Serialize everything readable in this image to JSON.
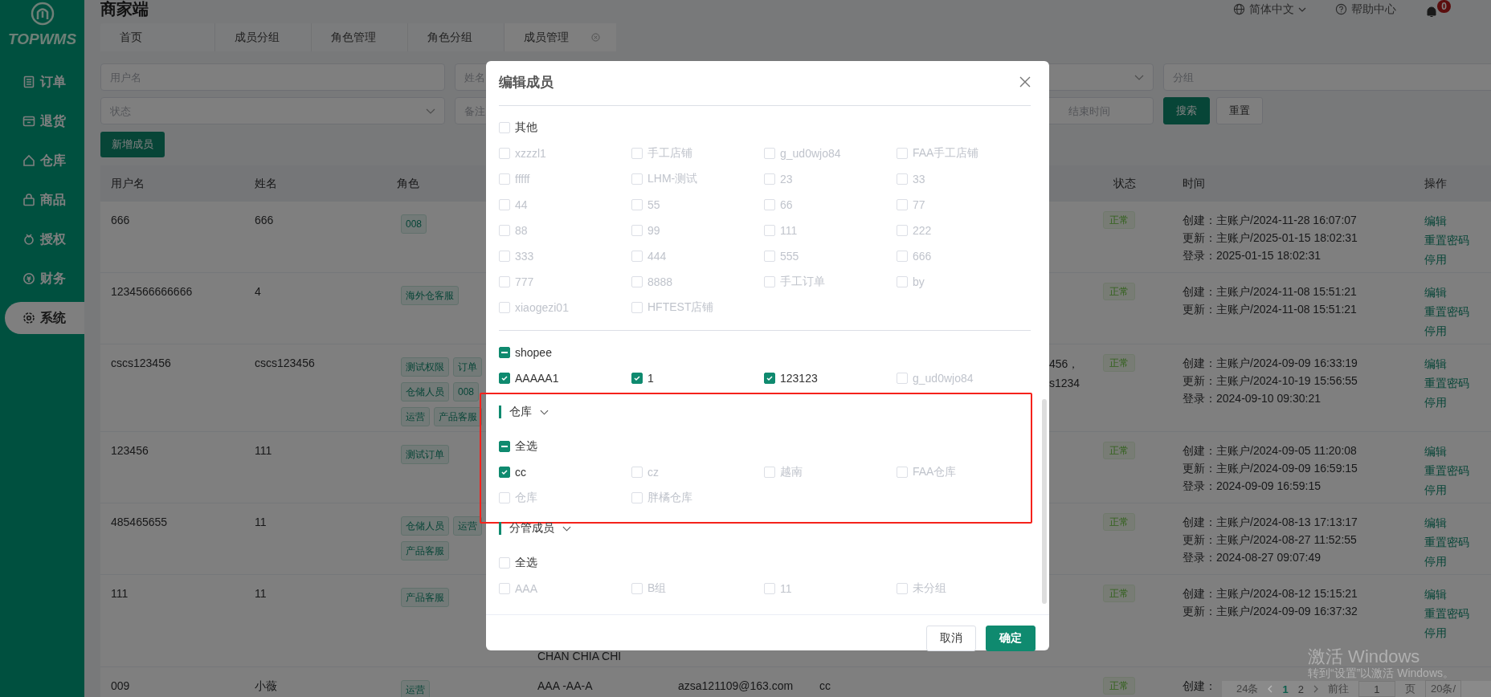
{
  "app": {
    "logo": "TOPWMS",
    "title": "商家端"
  },
  "sidebar": {
    "items": [
      {
        "label": "订单",
        "selected": false
      },
      {
        "label": "退货",
        "selected": false
      },
      {
        "label": "仓库",
        "selected": false
      },
      {
        "label": "商品",
        "selected": false
      },
      {
        "label": "授权",
        "selected": false
      },
      {
        "label": "财务",
        "selected": false
      },
      {
        "label": "系统",
        "selected": true
      }
    ]
  },
  "header": {
    "language": "简体中文",
    "help": "帮助中心",
    "notifications": "0"
  },
  "tabs": [
    {
      "label": "首页",
      "selected": false,
      "closable": false
    },
    {
      "label": "成员分组",
      "selected": false,
      "closable": false
    },
    {
      "label": "角色管理",
      "selected": false,
      "closable": false
    },
    {
      "label": "角色分组",
      "selected": false,
      "closable": false
    },
    {
      "label": "成员管理",
      "selected": true,
      "closable": true
    }
  ],
  "filters": {
    "rows": [
      [
        {
          "kind": "input",
          "placeholder": "用户名"
        },
        {
          "kind": "input",
          "placeholder": "姓名"
        },
        {
          "kind": "select"
        },
        {
          "kind": "input",
          "placeholder": "分组"
        }
      ],
      [
        {
          "kind": "select",
          "placeholder": "状态"
        },
        {
          "kind": "input",
          "placeholder": "备注"
        },
        {
          "kind": "daterange",
          "end_placeholder": "结束时间"
        },
        {
          "kind": "button",
          "label": "搜索",
          "primary": true
        },
        {
          "kind": "button",
          "label": "重置",
          "primary": false
        }
      ]
    ]
  },
  "toolbar": {
    "add_button": "新增成员"
  },
  "table": {
    "header": {
      "username": "用户名",
      "name": "姓名",
      "role": "角色",
      "status": "状态",
      "time": "时间",
      "actions": "操作"
    },
    "rows": [
      {
        "username": "666",
        "name": "666",
        "roles": [
          "008"
        ],
        "status": "正常",
        "times": [
          "创建：主账户/2024-11-28 16:07:07",
          "更新：主账户/2025-01-15 18:02:31",
          "登录：2025-01-15 18:02:31"
        ],
        "actions": [
          "编辑",
          "重置密码",
          "停用"
        ]
      },
      {
        "username": "1234566666666",
        "name": "4",
        "roles": [
          "海外仓客服"
        ],
        "status": "正常",
        "times": [
          "创建：主账户/2024-11-08 15:51:21",
          "更新：主账户/2024-11-08 15:51:21"
        ],
        "actions": [
          "编辑",
          "重置密码",
          "停用"
        ]
      },
      {
        "username": "cscs123456",
        "name": "cscs123456",
        "roles": [
          "测试权限",
          "订单",
          "仓储人员",
          "008",
          "运营",
          "产品客服"
        ],
        "column_7": "456，\ns1234",
        "status": "正常",
        "times": [
          "创建：主账户/2024-09-09 16:33:19",
          "更新：主账户/2024-10-19 15:56:55",
          "登录：2024-09-10 09:30:21"
        ],
        "actions": [
          "编辑",
          "重置密码",
          "停用"
        ]
      },
      {
        "username": "123456",
        "name": "111",
        "roles": [
          "测试订单"
        ],
        "status": "正常",
        "times": [
          "创建：主账户/2024-09-05 11:20:08",
          "更新：主账户/2024-09-09 16:59:15",
          "登录：2024-09-09 16:59:15"
        ],
        "actions": [
          "编辑",
          "重置密码",
          "停用"
        ]
      },
      {
        "username": "485465655",
        "name": "11",
        "roles": [
          "仓储人员",
          "运营",
          "产品客服"
        ],
        "status": "正常",
        "times": [
          "创建：主账户/2024-08-13 17:13:17",
          "更新：主账户/2024-08-27 11:52:55",
          "登录：2024-08-27 09:07:49"
        ],
        "actions": [
          "编辑",
          "重置密码",
          "停用"
        ]
      },
      {
        "username": "111",
        "name": "11",
        "roles": [
          "产品客服"
        ],
        "column_4": "CHAN CHIA CHI",
        "status": "正常",
        "times": [
          "创建：主账户/2024-08-12 15:15:21",
          "更新：主账户/2024-09-09 16:37:32"
        ],
        "actions": [
          "编辑",
          "重置密码",
          "停用"
        ]
      },
      {
        "username": "009",
        "name": "小薇",
        "roles": [
          "运营"
        ],
        "column_4": "AAA -AA-A",
        "column_5": "azsa121109@163.com",
        "column_6": "cc",
        "status": "正常",
        "times": [
          "创建："
        ]
      }
    ]
  },
  "pagination": {
    "total": "24条",
    "pages": [
      {
        "label": "1",
        "selected": true
      },
      {
        "label": "2",
        "selected": false
      }
    ],
    "goto_label": "前往",
    "goto_value": "1",
    "page_unit": "页",
    "page_size": "20条/"
  },
  "dialog": {
    "title": "编辑成员",
    "groups": [
      {
        "label": "其他",
        "indeterminate": false,
        "items": [
          {
            "label": "xzzzl1",
            "checked": false
          },
          {
            "label": "手工店铺",
            "checked": false
          },
          {
            "label": "g_ud0wjo84",
            "checked": false
          },
          {
            "label": "FAA手工店铺",
            "checked": false
          },
          {
            "label": "fffff",
            "checked": false
          },
          {
            "label": "LHM-测试",
            "checked": false
          },
          {
            "label": "23",
            "checked": false
          },
          {
            "label": "33",
            "checked": false
          },
          {
            "label": "44",
            "checked": false
          },
          {
            "label": "55",
            "checked": false
          },
          {
            "label": "66",
            "checked": false
          },
          {
            "label": "77",
            "checked": false
          },
          {
            "label": "88",
            "checked": false
          },
          {
            "label": "99",
            "checked": false
          },
          {
            "label": "111",
            "checked": false
          },
          {
            "label": "222",
            "checked": false
          },
          {
            "label": "333",
            "checked": false
          },
          {
            "label": "444",
            "checked": false
          },
          {
            "label": "555",
            "checked": false
          },
          {
            "label": "666",
            "checked": false
          },
          {
            "label": "777",
            "checked": false
          },
          {
            "label": "8888",
            "checked": false
          },
          {
            "label": "手工订单",
            "checked": false
          },
          {
            "label": "by",
            "checked": false
          },
          {
            "label": "xiaogezi01",
            "checked": false
          },
          {
            "label": "HFTEST店铺",
            "checked": false
          }
        ]
      },
      {
        "label": "shopee",
        "indeterminate": true,
        "items": [
          {
            "label": "AAAAA1",
            "checked": true
          },
          {
            "label": "1",
            "checked": true
          },
          {
            "label": "123123",
            "checked": true
          },
          {
            "label": "g_ud0wjo84",
            "checked": false
          }
        ]
      }
    ],
    "sections": [
      {
        "title": "仓库",
        "expanded": true,
        "highlighted": true,
        "select_all": {
          "label": "全选",
          "indeterminate": true
        },
        "items": [
          {
            "label": "cc",
            "checked": true
          },
          {
            "label": "cz",
            "checked": false
          },
          {
            "label": "越南",
            "checked": false
          },
          {
            "label": "FAA仓库",
            "checked": false
          },
          {
            "label": "仓库",
            "checked": false
          },
          {
            "label": "胖橘仓库",
            "checked": false
          }
        ]
      },
      {
        "title": "分管成员",
        "expanded": true,
        "highlighted": false,
        "select_all": {
          "label": "全选",
          "indeterminate": false
        },
        "items": [
          {
            "label": "AAA",
            "checked": false
          },
          {
            "label": "B组",
            "checked": false
          },
          {
            "label": "11",
            "checked": false
          },
          {
            "label": "未分组",
            "checked": false
          }
        ]
      }
    ],
    "buttons": [
      {
        "label": "取消",
        "primary": false
      },
      {
        "label": "确定",
        "primary": true
      }
    ]
  },
  "os_notice": {
    "title": "激活 Windows",
    "text": "转到“设置”以激活 Windows。"
  }
}
